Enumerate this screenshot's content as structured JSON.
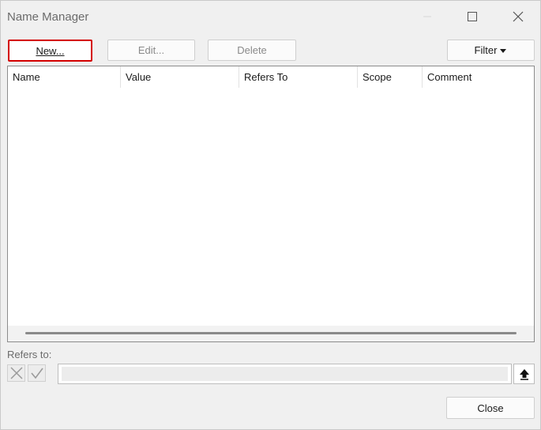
{
  "window": {
    "title": "Name Manager"
  },
  "toolbar": {
    "new_label": "New...",
    "edit_label": "Edit...",
    "delete_label": "Delete",
    "filter_label": "Filter"
  },
  "list": {
    "columns": [
      "Name",
      "Value",
      "Refers To",
      "Scope",
      "Comment"
    ],
    "rows": []
  },
  "refers_to": {
    "label": "Refers to:",
    "value": ""
  },
  "footer": {
    "close_label": "Close"
  },
  "colors": {
    "focus_outline": "#d40000",
    "window_bg": "#f0f0f0"
  }
}
